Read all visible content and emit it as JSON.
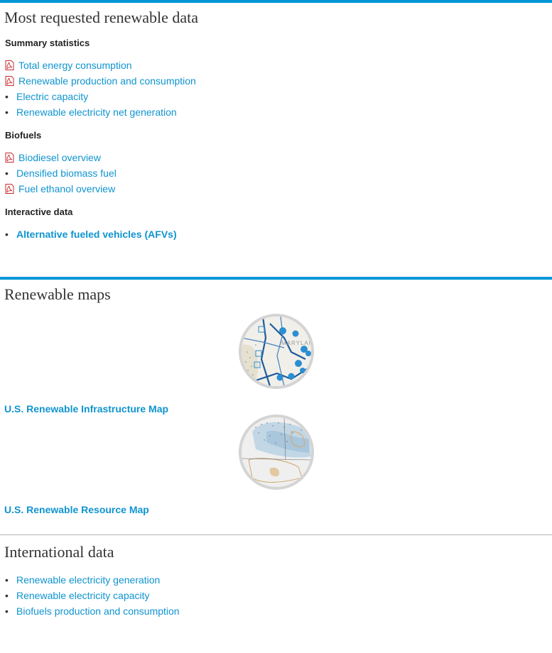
{
  "most_requested": {
    "title": "Most requested renewable data",
    "groups": [
      {
        "heading": "Summary statistics",
        "items": [
          {
            "label": "Total energy consumption",
            "icon": "pdf-icon"
          },
          {
            "label": "Renewable production and consumption",
            "icon": "pdf-icon"
          },
          {
            "label": "Electric capacity",
            "icon": "bullet"
          },
          {
            "label": "Renewable electricity net generation",
            "icon": "bullet"
          }
        ]
      },
      {
        "heading": "Biofuels",
        "items": [
          {
            "label": "Biodiesel overview",
            "icon": "pdf-icon"
          },
          {
            "label": "Densified biomass fuel",
            "icon": "bullet"
          },
          {
            "label": "Fuel ethanol overview",
            "icon": "pdf-icon"
          }
        ]
      },
      {
        "heading": "Interactive data",
        "items": [
          {
            "label": "Alternative fueled vehicles (AFVs)",
            "icon": "bullet"
          }
        ]
      }
    ]
  },
  "renewable_maps": {
    "title": "Renewable maps",
    "maps": [
      {
        "label": "U.S. Renewable Infrastructure Map",
        "thumb_text": "MARYLAND"
      },
      {
        "label": "U.S. Renewable Resource Map"
      }
    ]
  },
  "international": {
    "title": "International data",
    "items": [
      "Renewable electricity generation",
      "Renewable electricity capacity",
      "Biofuels production and consumption"
    ]
  },
  "colors": {
    "accent_rule": "#0096d7",
    "link": "#0f94d0",
    "pdf_red": "#c8282d"
  }
}
